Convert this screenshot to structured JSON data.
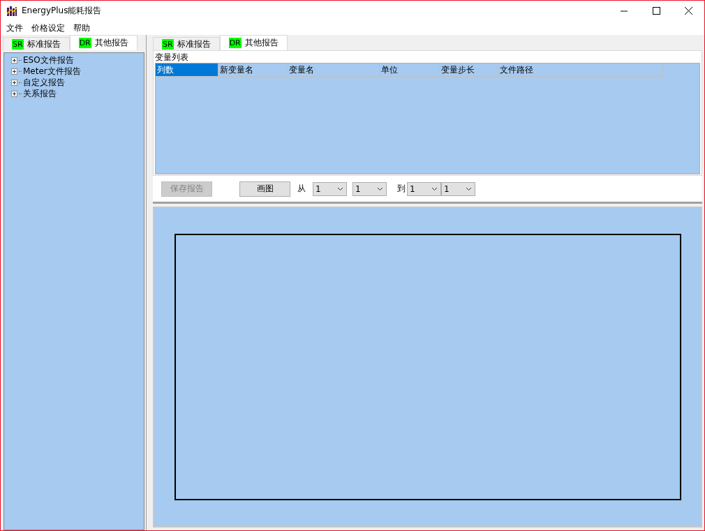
{
  "window": {
    "title": "EnergyPlus能耗报告"
  },
  "menu": [
    "文件",
    "价格设定",
    "帮助"
  ],
  "left_tabs": [
    {
      "badge": "SR",
      "label": "标准报告",
      "selected": false
    },
    {
      "badge": "DR",
      "label": "其他报告",
      "selected": true
    }
  ],
  "tree": [
    {
      "label": "ESO文件报告",
      "expanded": false
    },
    {
      "label": "Meter文件报告",
      "expanded": false
    },
    {
      "label": "自定义报告",
      "expanded": false
    },
    {
      "label": "关系报告",
      "expanded": false
    }
  ],
  "right_tabs": [
    {
      "badge": "SR",
      "label": "标准报告",
      "selected": false
    },
    {
      "badge": "DR",
      "label": "其他报告",
      "selected": true
    }
  ],
  "variable_list": {
    "title": "变量列表",
    "columns": [
      {
        "label": "列数",
        "selected": true
      },
      {
        "label": "新变量名",
        "selected": false
      },
      {
        "label": "变量名",
        "selected": false
      },
      {
        "label": "单位",
        "selected": false
      },
      {
        "label": "变量步长",
        "selected": false
      },
      {
        "label": "文件路径",
        "selected": false
      }
    ]
  },
  "controls": {
    "save_button": {
      "label": "保存报告",
      "disabled": true
    },
    "plot_button": {
      "label": "画图",
      "disabled": false
    },
    "from_label": "从",
    "from": [
      "1",
      "1"
    ],
    "to_label": "到",
    "to": [
      "1",
      "1"
    ]
  }
}
